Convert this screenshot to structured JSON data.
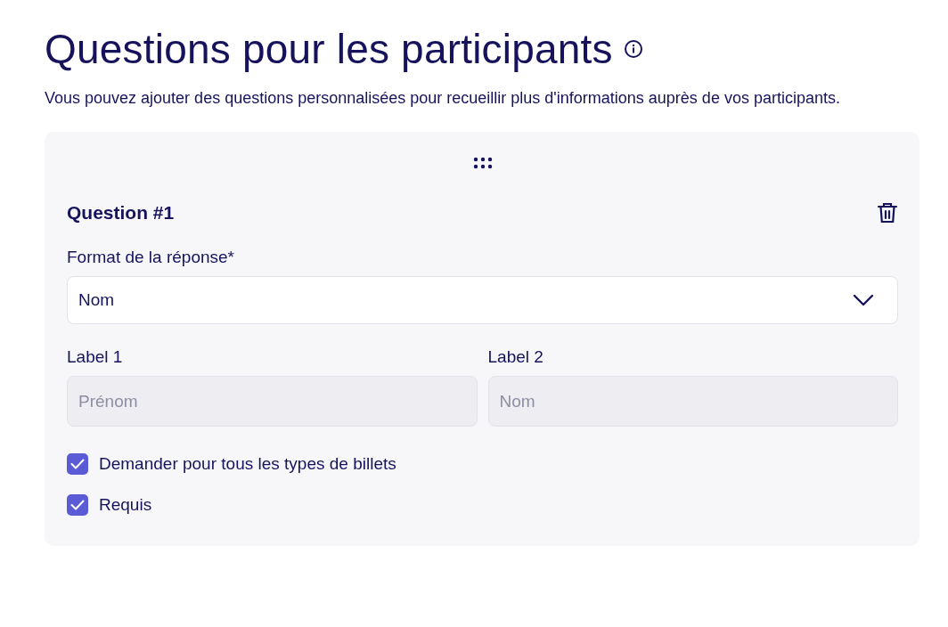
{
  "title": "Questions pour les participants",
  "description": "Vous pouvez ajouter des questions personnalisées pour recueillir plus d'informations auprès de vos participants.",
  "questions": [
    {
      "title": "Question #1",
      "format": {
        "label": "Format de la réponse*",
        "value": "Nom"
      },
      "fields": [
        {
          "label": "Label 1",
          "placeholder": "Prénom",
          "disabled": true
        },
        {
          "label": "Label 2",
          "placeholder": "Nom",
          "disabled": true
        }
      ],
      "options": [
        {
          "label": "Demander pour tous les types de billets",
          "checked": true
        },
        {
          "label": "Requis",
          "checked": true
        }
      ]
    }
  ]
}
